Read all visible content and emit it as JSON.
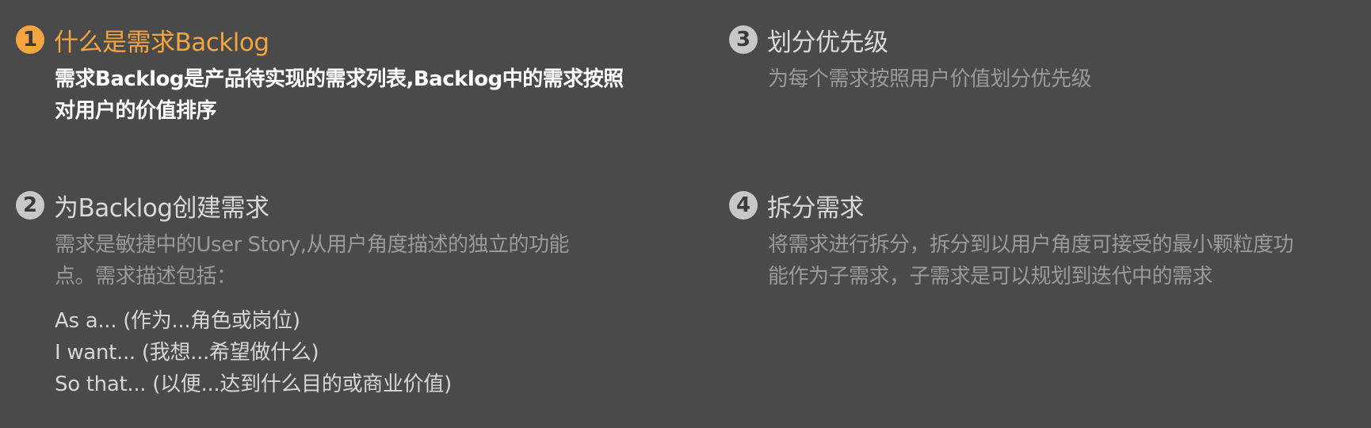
{
  "sections": [
    {
      "number": "1",
      "title": "什么是需求Backlog",
      "body_lines": [
        "需求Backlog是产品待实现的需求列表,Backlog中的需求按照",
        "对用户的价值排序"
      ]
    },
    {
      "number": "2",
      "title": "为Backlog创建需求",
      "body_lines": [
        "需求是敏捷中的User Story,从用户角度描述的独立的功能",
        "点。需求描述包括："
      ],
      "items": [
        "As a... (作为...角色或岗位)",
        "I want... (我想...希望做什么)",
        "So that... (以便...达到什么目的或商业价值)"
      ]
    },
    {
      "number": "3",
      "title": "划分优先级",
      "body_lines": [
        "为每个需求按照用户价值划分优先级"
      ]
    },
    {
      "number": "4",
      "title": "拆分需求",
      "body_lines": [
        "将需求进行拆分，拆分到以用户角度可接受的最小颗粒度功",
        "能作为子需求，子需求是可以规划到迭代中的需求"
      ]
    }
  ],
  "colors": {
    "background": "#4a4a4a",
    "accent": "#f5a53f",
    "inactive_badge": "#c8c8c8",
    "active_text": "#ffffff",
    "inactive_text": "#9a9a9a"
  }
}
